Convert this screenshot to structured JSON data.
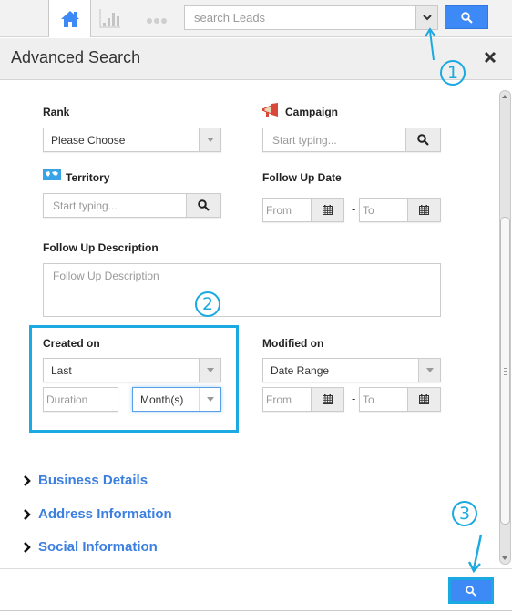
{
  "topbar": {
    "nav": [
      {
        "name": "home",
        "icon": "home-icon",
        "active": true
      },
      {
        "name": "reports",
        "icon": "bar-chart-icon",
        "active": false
      },
      {
        "name": "more",
        "icon": "more-dots-icon",
        "active": false
      }
    ],
    "search": {
      "placeholder": "search Leads",
      "value": "",
      "dropdown_icon": "chevron-down-icon",
      "button_icon": "search-icon"
    }
  },
  "panel": {
    "title": "Advanced Search",
    "close_icon": "close-icon"
  },
  "form": {
    "rank": {
      "label": "Rank",
      "value": "Please Choose"
    },
    "campaign": {
      "label": "Campaign",
      "icon": "megaphone-icon",
      "placeholder": "Start typing..."
    },
    "territory": {
      "label": "Territory",
      "icon": "world-map-icon",
      "placeholder": "Start typing..."
    },
    "follow_up_date": {
      "label": "Follow Up Date",
      "from_placeholder": "From",
      "to_placeholder": "To",
      "separator": "-"
    },
    "follow_up_description": {
      "label": "Follow Up Description",
      "placeholder": "Follow Up Description"
    },
    "created_on": {
      "label": "Created on",
      "value": "Last",
      "duration_placeholder": "Duration",
      "unit_value": "Month(s)"
    },
    "modified_on": {
      "label": "Modified on",
      "value": "Date Range",
      "from_placeholder": "From",
      "to_placeholder": "To",
      "separator": "-"
    }
  },
  "sections": [
    {
      "label": "Business Details"
    },
    {
      "label": "Address Information"
    },
    {
      "label": "Social Information"
    }
  ],
  "footer": {
    "search_icon": "search-icon"
  },
  "annotations": [
    {
      "number": "1"
    },
    {
      "number": "2"
    },
    {
      "number": "3"
    }
  ],
  "colors": {
    "accent_blue": "#3d8af7",
    "link_blue": "#3b7fe0",
    "annotation_cyan": "#1aa9e0"
  }
}
